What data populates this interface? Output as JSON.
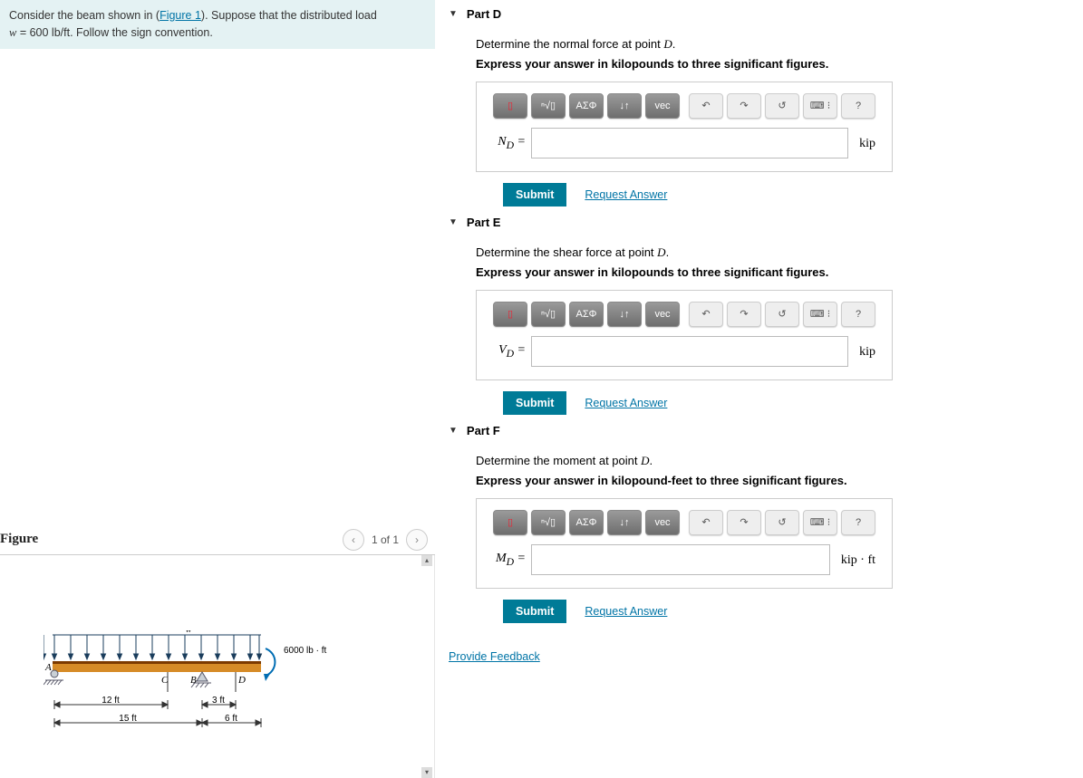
{
  "problem": {
    "prefix": "Consider the beam shown in (",
    "figure_ref": "Figure 1",
    "suffix": "). Suppose that the distributed load",
    "line2_prefix": "w",
    "line2_mid": " = 600 lb/ft. Follow the sign convention."
  },
  "figure": {
    "title": "Figure",
    "nav_label": "1 of 1",
    "nav_prev": "‹",
    "nav_next": "›",
    "scroll_up": "▴",
    "scroll_down": "▾",
    "labels": {
      "w": "w",
      "moment": "6000 lb · ft",
      "A": "A",
      "B": "B",
      "C": "C",
      "D": "D",
      "d12": "12 ft",
      "d3": "3 ft",
      "d15": "15 ft",
      "d6": "6 ft"
    }
  },
  "toolbar": {
    "tmpl": "▯",
    "sqrt": "ⁿ√▯",
    "greek": "ΑΣΦ",
    "arrows": "↓↑",
    "vec": "vec",
    "undo": "↶",
    "redo": "↷",
    "reset": "↺",
    "kbd": "⌨ ⁝",
    "help": "?"
  },
  "parts": [
    {
      "key": "D",
      "title": "Part D",
      "prompt_prefix": "Determine the normal force at point ",
      "prompt_var": "D",
      "prompt_suffix": ".",
      "hint": "Express your answer in kilopounds to three significant figures.",
      "label_html": "N",
      "unit": "kip"
    },
    {
      "key": "E",
      "title": "Part E",
      "prompt_prefix": "Determine the shear force at point ",
      "prompt_var": "D",
      "prompt_suffix": ".",
      "hint": "Express your answer in kilopounds to three significant figures.",
      "label_html": "V",
      "unit": "kip"
    },
    {
      "key": "F",
      "title": "Part F",
      "prompt_prefix": "Determine the moment at point ",
      "prompt_var": "D",
      "prompt_suffix": ".",
      "hint": "Express your answer in kilopound-feet to three significant figures.",
      "label_html": "M",
      "unit": "kip · ft"
    }
  ],
  "actions": {
    "submit": "Submit",
    "request": "Request Answer",
    "feedback": "Provide Feedback"
  },
  "misc": {
    "equals": " ="
  }
}
